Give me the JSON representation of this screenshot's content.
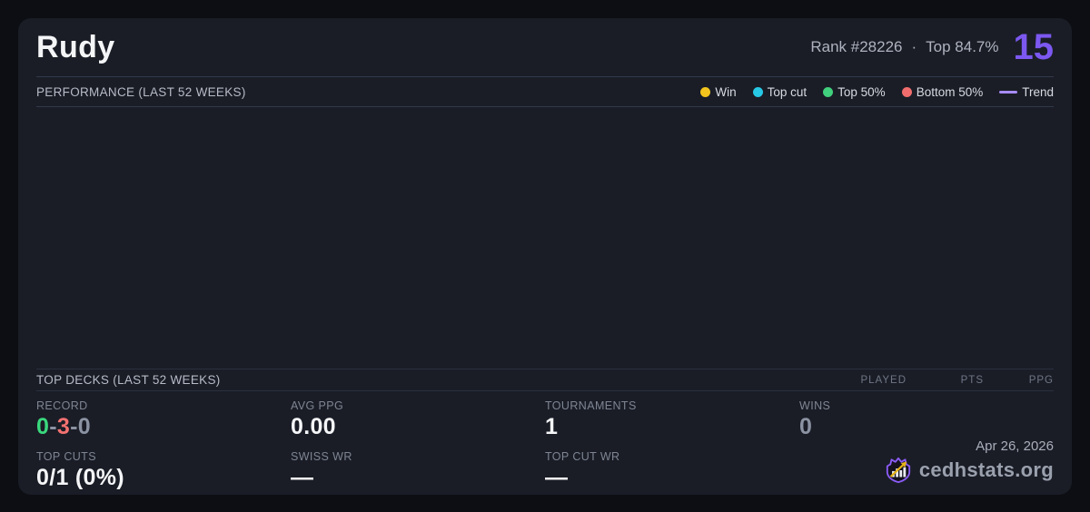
{
  "colors": {
    "accent_purple": "#7c58f0",
    "muted_grey": "#8b92a2"
  },
  "header": {
    "player_name": "Rudy",
    "rank": "Rank #28226",
    "dot_separator": "·",
    "top_percent": "Top 84.7%",
    "points": "15"
  },
  "performance": {
    "title": "PERFORMANCE (LAST 52 WEEKS)",
    "legend": [
      {
        "label": "Win",
        "color": "#f2c41d"
      },
      {
        "label": "Top cut",
        "color": "#27c8e6"
      },
      {
        "label": "Top 50%",
        "color": "#41d07d"
      },
      {
        "label": "Bottom 50%",
        "color": "#f16d6d"
      },
      {
        "label": "Trend",
        "color": "#a78bfa"
      }
    ]
  },
  "top_decks": {
    "title": "TOP DECKS (LAST 52 WEEKS)",
    "columns": [
      "PLAYED",
      "PTS",
      "PPG"
    ],
    "rows": []
  },
  "stats": {
    "record": {
      "label": "RECORD",
      "parts": [
        {
          "text": "0",
          "color": "#3ad97e"
        },
        {
          "text": "-",
          "color": "#8b92a2"
        },
        {
          "text": "3",
          "color": "#f47171"
        },
        {
          "text": "-",
          "color": "#8b92a2"
        },
        {
          "text": "0",
          "color": "#8b92a2"
        }
      ]
    },
    "avg_ppg": {
      "label": "AVG PPG",
      "value": "0.00"
    },
    "tournaments": {
      "label": "TOURNAMENTS",
      "value": "1"
    },
    "wins": {
      "label": "WINS",
      "value": "0"
    },
    "top_cuts": {
      "label": "TOP CUTS",
      "value": "0/1 (0%)"
    },
    "swiss_wr": {
      "label": "SWISS WR",
      "value": "—"
    },
    "top_cut_wr": {
      "label": "TOP CUT WR",
      "value": "—"
    }
  },
  "footer": {
    "date": "Apr 26, 2026",
    "brand": "cedhstats.org"
  }
}
